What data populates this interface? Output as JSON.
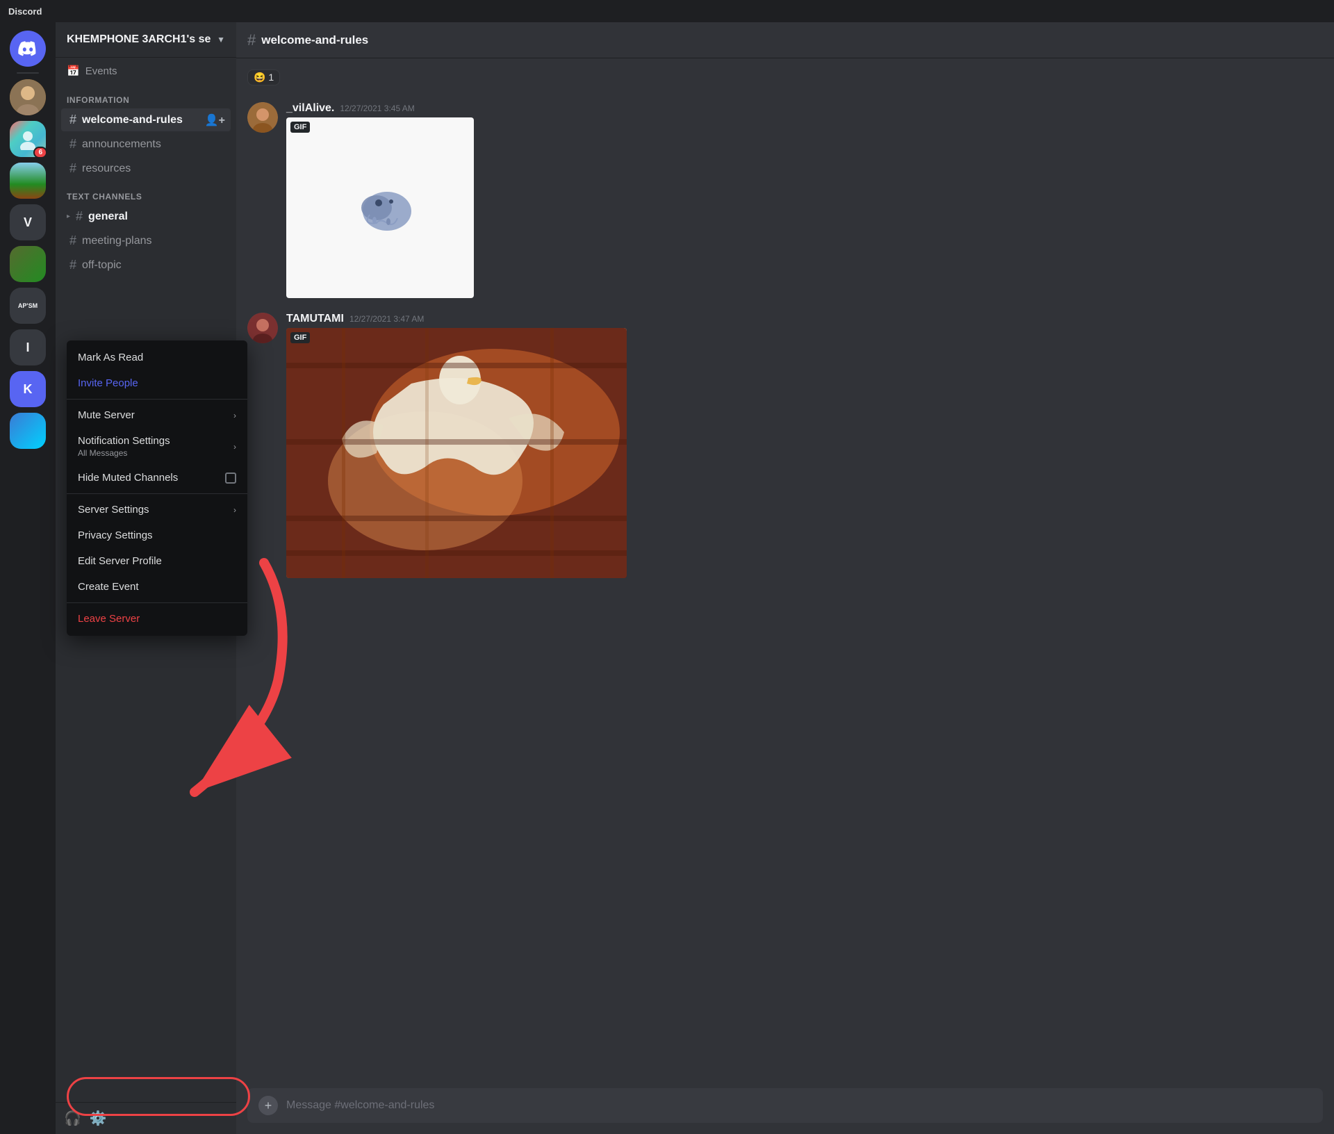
{
  "app": {
    "title": "Discord"
  },
  "server_sidebar": {
    "icons": [
      {
        "id": "discord-home",
        "label": "Discord Home",
        "type": "discord"
      },
      {
        "id": "server-1",
        "label": "User Server 1",
        "type": "avatar",
        "colorClass": "user-icon-1"
      },
      {
        "id": "server-2",
        "label": "User Server 2",
        "type": "avatar",
        "colorClass": "user-icon-2",
        "badge": "6"
      },
      {
        "id": "server-3",
        "label": "User Server 3",
        "type": "avatar",
        "colorClass": "user-icon-3"
      },
      {
        "id": "server-v",
        "label": "V Server",
        "type": "text",
        "text": "V"
      },
      {
        "id": "server-4",
        "label": "User Server 4",
        "type": "avatar",
        "colorClass": "user-icon-4"
      },
      {
        "id": "server-apsm",
        "label": "APSM Server",
        "type": "text",
        "text": "AP'SM"
      },
      {
        "id": "server-5",
        "label": "User Server 5",
        "type": "text",
        "text": "I"
      },
      {
        "id": "server-k",
        "label": "K Server",
        "type": "text",
        "text": "K",
        "colorClass": "si-blue"
      },
      {
        "id": "server-6",
        "label": "User Server 6",
        "type": "avatar",
        "colorClass": "user-icon-5"
      }
    ]
  },
  "channel_sidebar": {
    "server_name": "KHEMPHONE 3ARCH1's se",
    "events_label": "Events",
    "categories": [
      {
        "name": "INFORMATION",
        "channels": [
          {
            "id": "welcome-and-rules",
            "name": "welcome-and-rules",
            "active": true
          },
          {
            "id": "announcements",
            "name": "announcements"
          },
          {
            "id": "resources",
            "name": "resources"
          }
        ]
      },
      {
        "name": "TEXT CHANNELS",
        "channels": [
          {
            "id": "general",
            "name": "general",
            "bullet": true
          },
          {
            "id": "meeting-plans",
            "name": "meeting-plans"
          },
          {
            "id": "off-topic",
            "name": "off-topic"
          }
        ]
      }
    ]
  },
  "channel_header": {
    "name": "welcome-and-rules"
  },
  "messages": [
    {
      "id": "msg-reaction",
      "reaction": "😆 1"
    },
    {
      "id": "msg-vilalive",
      "username": "_vilAlive.",
      "timestamp": "12/27/2021 3:45 AM",
      "has_gif": true,
      "gif_type": "bird"
    },
    {
      "id": "msg-tamutami",
      "username": "TAMUTAMI",
      "timestamp": "12/27/2021 3:47 AM",
      "has_gif": true,
      "gif_type": "seagull"
    }
  ],
  "message_input": {
    "placeholder": "Message #welcome-and-rules"
  },
  "context_menu": {
    "items": [
      {
        "id": "mark-as-read",
        "label": "Mark As Read",
        "type": "normal"
      },
      {
        "id": "invite-people",
        "label": "Invite People",
        "type": "invite"
      },
      {
        "id": "mute-server",
        "label": "Mute Server",
        "type": "submenu"
      },
      {
        "id": "notification-settings",
        "label": "Notification Settings",
        "sublabel": "All Messages",
        "type": "submenu"
      },
      {
        "id": "hide-muted-channels",
        "label": "Hide Muted Channels",
        "type": "checkbox"
      },
      {
        "id": "server-settings",
        "label": "Server Settings",
        "type": "submenu"
      },
      {
        "id": "privacy-settings",
        "label": "Privacy Settings",
        "type": "normal"
      },
      {
        "id": "edit-server-profile",
        "label": "Edit Server Profile",
        "type": "normal"
      },
      {
        "id": "create-event",
        "label": "Create Event",
        "type": "normal"
      },
      {
        "id": "leave-server",
        "label": "Leave Server",
        "type": "danger"
      }
    ]
  },
  "bottom_bar": {
    "headphone_label": "Headphones",
    "settings_label": "User Settings"
  }
}
